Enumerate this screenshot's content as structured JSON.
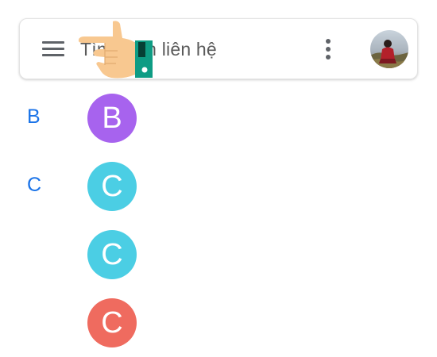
{
  "search": {
    "text": "Tìm kiếm liên hệ"
  },
  "sections": [
    {
      "letter": "B",
      "contacts": [
        {
          "initial": "B",
          "color": "#a763ee"
        }
      ]
    },
    {
      "letter": "C",
      "contacts": [
        {
          "initial": "C",
          "color": "#4bcee4"
        },
        {
          "initial": "C",
          "color": "#4bcee4"
        },
        {
          "initial": "C",
          "color": "#ef6b5f"
        }
      ]
    }
  ],
  "icons": {
    "menu": "hamburger-menu-icon",
    "more": "more-vert-icon",
    "avatar": "profile-photo",
    "pointer": "pointing-hand"
  },
  "colors": {
    "section_letter": "#1a73e8",
    "icon_gray": "#5f6368",
    "skin": "#f8c890",
    "sleeve": "#0e9c84"
  }
}
